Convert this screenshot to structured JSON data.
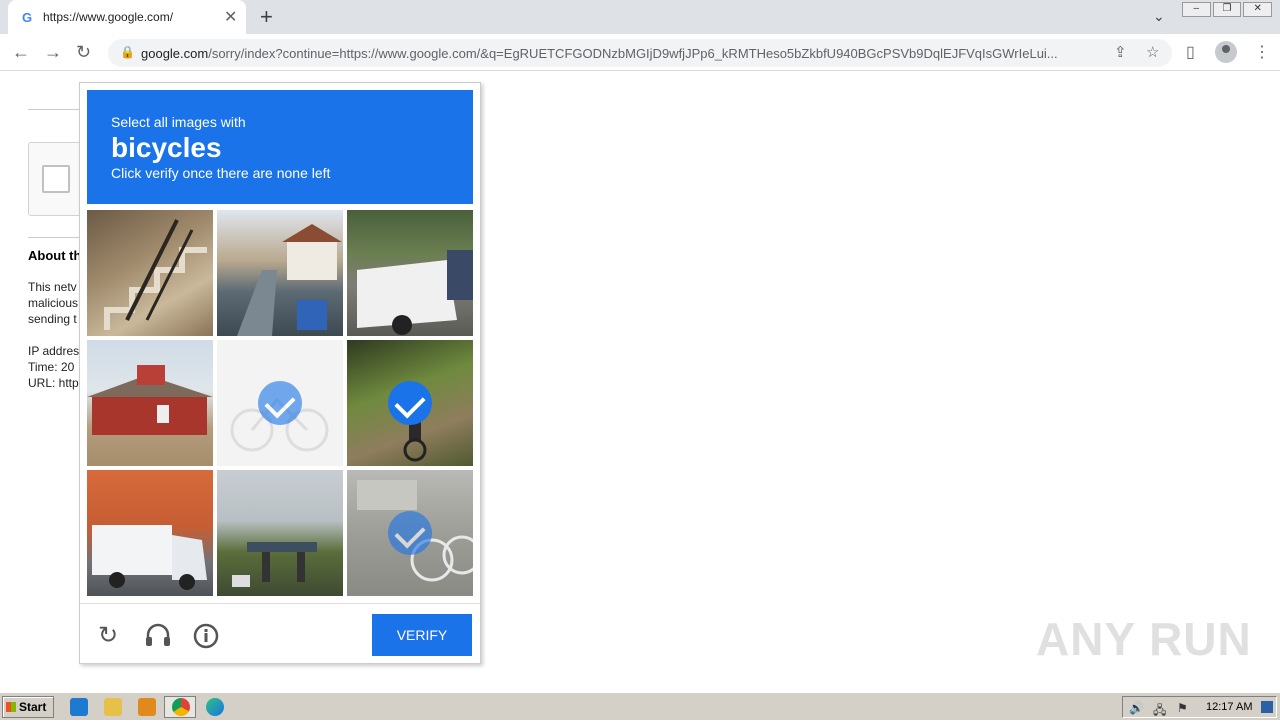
{
  "browser": {
    "tab_title": "https://www.google.com/",
    "tab_favicon": "G",
    "tab_close": "✕",
    "new_tab": "+",
    "url_host": "google.com",
    "url_path": "/sorry/index?continue=https://www.google.com/&q=EgRUETCFGODNzbMGIjD9wfjJPp6_kRMTHeso5bZkbfU940BGcPSVb9DqlEJFVqIsGWrIeLui..."
  },
  "background_page": {
    "about_title": "About th",
    "para1": [
      "This netv",
      "malicious",
      "sending t"
    ],
    "para2": [
      "IP addres",
      "Time: 20",
      "URL: http"
    ]
  },
  "captcha": {
    "instruction_line1": "Select all images with",
    "target": "bicycles",
    "instruction_line3": "Click verify once there are none left",
    "verify_label": "VERIFY",
    "tiles": [
      {
        "id": "stairs-railing",
        "selected": false
      },
      {
        "id": "street-houses",
        "selected": false
      },
      {
        "id": "white-pickup-truck",
        "selected": false
      },
      {
        "id": "red-house",
        "selected": false
      },
      {
        "id": "bicycle-faded",
        "selected": true
      },
      {
        "id": "cyclist-path",
        "selected": true
      },
      {
        "id": "delivery-van",
        "selected": false
      },
      {
        "id": "bridge-road",
        "selected": false
      },
      {
        "id": "bicycle-parked",
        "selected": true
      }
    ]
  },
  "watermark": "ANY RUN",
  "taskbar": {
    "start_label": "Start",
    "clock": "12:17 AM"
  }
}
